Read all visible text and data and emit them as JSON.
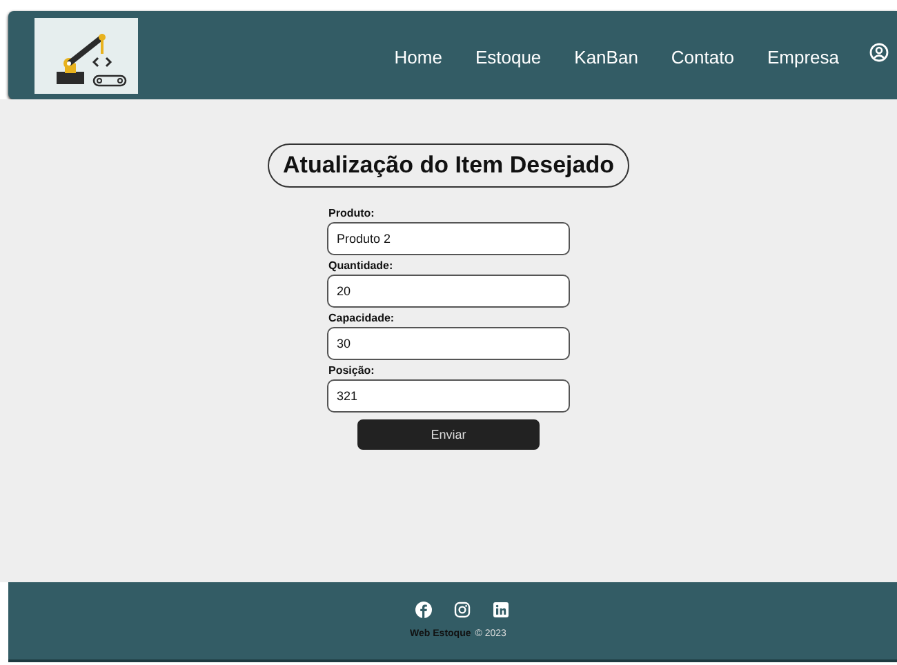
{
  "nav": {
    "items": [
      {
        "label": "Home"
      },
      {
        "label": "Estoque"
      },
      {
        "label": "KanBan"
      },
      {
        "label": "Contato"
      },
      {
        "label": "Empresa"
      }
    ]
  },
  "form": {
    "title": "Atualização do Item Desejado",
    "fields": [
      {
        "label": "Produto:",
        "value": "Produto 2"
      },
      {
        "label": "Quantidade:",
        "value": "20"
      },
      {
        "label": "Capacidade:",
        "value": "30"
      },
      {
        "label": "Posição:",
        "value": "321"
      }
    ],
    "submit": "Enviar"
  },
  "footer": {
    "brand": "Web Estoque",
    "copyright": "© 2023"
  }
}
